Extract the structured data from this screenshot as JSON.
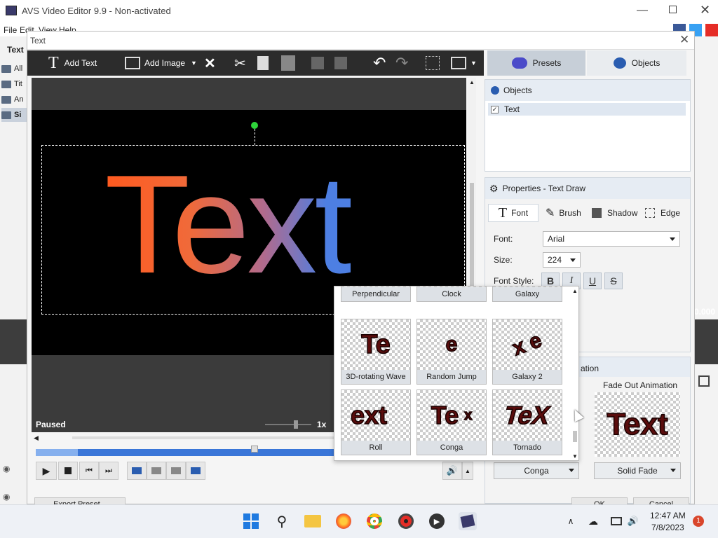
{
  "app": {
    "title": "AVS Video Editor 9.9 - Non-activated",
    "menu": [
      "File",
      "Edit",
      "View",
      "Help"
    ],
    "left_tab": "Text",
    "bg_items": [
      "All",
      "Tit",
      "An",
      "Si"
    ],
    "right_value": "0.000"
  },
  "dialog": {
    "title": "Text",
    "toolbar": {
      "add_text": "Add Text",
      "add_image": "Add Image"
    },
    "tabs": {
      "presets": "Presets",
      "objects": "Objects"
    },
    "preview": {
      "text": "Text",
      "status": "Paused",
      "speed": "1x"
    },
    "objects_panel": {
      "title": "Objects",
      "items": [
        "Text"
      ]
    },
    "properties": {
      "title": "Properties - Text Draw",
      "tabs": [
        "Font",
        "Brush",
        "Shadow",
        "Edge"
      ],
      "font_label": "Font:",
      "font_value": "Arial",
      "size_label": "Size:",
      "size_value": "224",
      "style_label": "Font Style:",
      "styles": [
        "B",
        "I",
        "U",
        "S"
      ]
    },
    "animation": {
      "title_partial": "ation",
      "fade_out_label": "Fade Out Animation",
      "fade_out_preview": "Text",
      "in_value": "Conga",
      "out_value": "Solid Fade"
    },
    "bottom_buttons": {
      "left": "Export Preset...",
      "ok": "OK",
      "cancel": "Cancel"
    }
  },
  "popup": {
    "rows": [
      [
        "Perpendicular",
        "Clock",
        "Galaxy"
      ],
      [
        "3D-rotating Wave",
        "Random Jump",
        "Galaxy 2"
      ],
      [
        "Roll",
        "Conga",
        "Tornado"
      ]
    ],
    "thumb_texts": {
      "wave": "Te",
      "jump": "e",
      "galaxy2": "x e",
      "roll": "ext",
      "conga": "Te",
      "conga_x": "x",
      "tornado": "TeX"
    }
  },
  "taskbar": {
    "time": "12:47 AM",
    "date": "7/8/2023",
    "badge": "1"
  }
}
